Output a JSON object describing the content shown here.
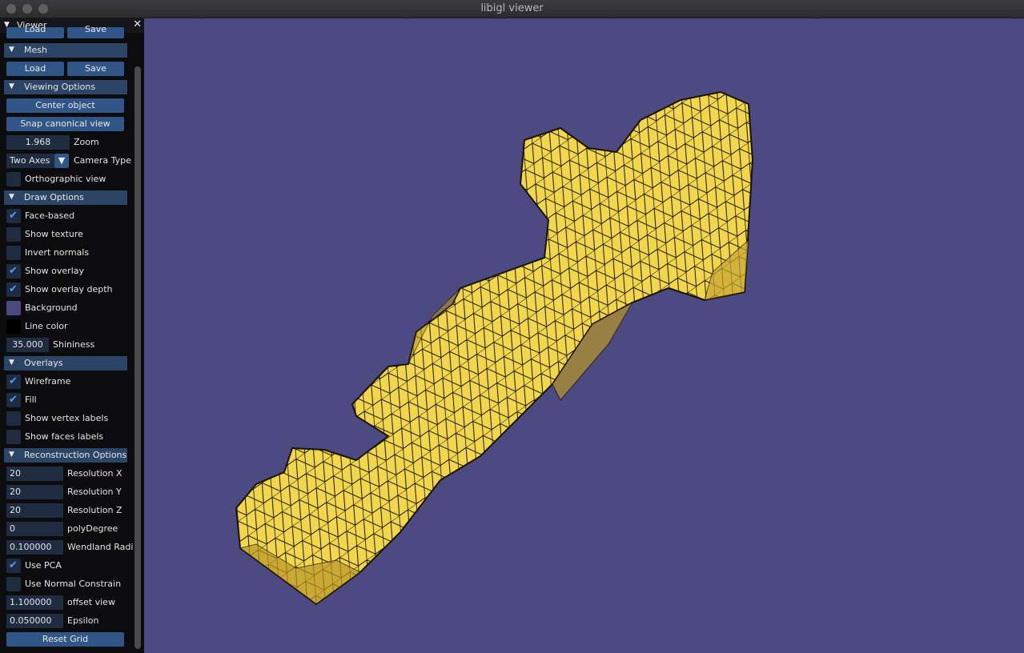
{
  "window": {
    "title": "libigl viewer"
  },
  "panel": {
    "title": "Viewer",
    "top_partial": {
      "load": "Load",
      "save": "Save"
    },
    "mesh": {
      "header": "Mesh",
      "load": "Load",
      "save": "Save"
    },
    "viewing": {
      "header": "Viewing Options",
      "center": "Center object",
      "snap": "Snap canonical view",
      "zoom_value": "1.968",
      "zoom_label": "Zoom",
      "camera_value": "Two Axes",
      "camera_label": "Camera Type",
      "ortho_label": "Orthographic view"
    },
    "draw": {
      "header": "Draw Options",
      "face_based": "Face-based",
      "show_texture": "Show texture",
      "invert_normals": "Invert normals",
      "show_overlay": "Show overlay",
      "show_overlay_depth": "Show overlay depth",
      "background": "Background",
      "line_color": "Line color",
      "shininess_value": "35.000",
      "shininess_label": "Shininess",
      "background_color": "#4c4a80",
      "line_color_value": "#000000"
    },
    "overlays": {
      "header": "Overlays",
      "wireframe": "Wireframe",
      "fill": "Fill",
      "vertex_labels": "Show vertex labels",
      "faces_labels": "Show faces labels"
    },
    "recon": {
      "header": "Reconstruction Options",
      "res_x_value": "20",
      "res_x_label": "Resolution X",
      "res_y_value": "20",
      "res_y_label": "Resolution Y",
      "res_z_value": "20",
      "res_z_label": "Resolution Z",
      "poly_value": "0",
      "poly_label": "polyDegree",
      "wendland_value": "0.100000",
      "wendland_label": "Wendland Radi",
      "use_pca": "Use PCA",
      "normal_constrain": "Use Normal Constrain",
      "offset_value": "1.100000",
      "offset_label": "offset view",
      "epsilon_value": "0.050000",
      "epsilon_label": "Epsilon",
      "reset": "Reset Grid"
    }
  },
  "checkmark": "✔",
  "colors": {
    "mesh_fill": "#f0d54a",
    "mesh_shade": "#c9a92e",
    "accent": "#2f5686"
  }
}
